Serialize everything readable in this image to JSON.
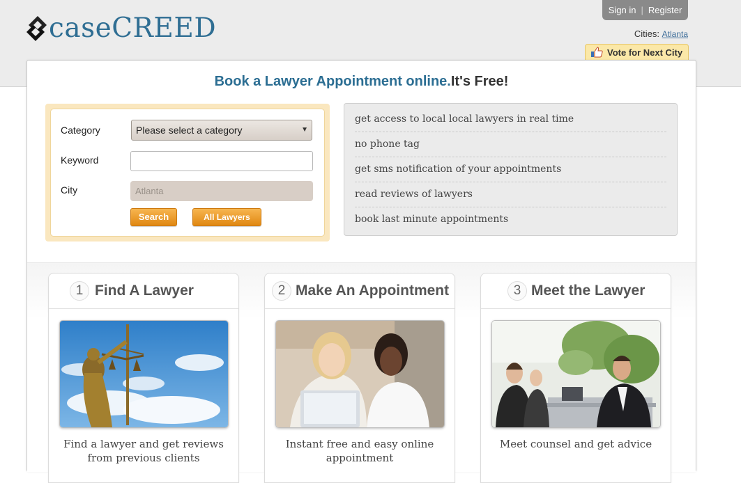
{
  "brand": {
    "logo_text": "caseCREED",
    "logo_icon": "arrow-c-logo-icon",
    "color": "#2f6e93"
  },
  "auth": {
    "sign_in": "Sign in",
    "separator": "|",
    "register": "Register"
  },
  "cities": {
    "label": "Cities:",
    "current": "Atlanta"
  },
  "vote": {
    "label": "Vote for Next City",
    "icon": "thumbs-up-icon"
  },
  "headline": {
    "part1": "Book a Lawyer Appointment online.",
    "part2": "It's Free!"
  },
  "form": {
    "category_label": "Category",
    "category_value": "Please select a category",
    "keyword_label": "Keyword",
    "keyword_value": "",
    "city_label": "City",
    "city_value": "Atlanta",
    "search_button": "Search",
    "all_lawyers_button": "All Lawyers"
  },
  "benefits": [
    "get access to local local lawyers in real time",
    "no phone tag",
    "get sms notification of your appointments",
    "read reviews of lawyers",
    "book last minute appointments"
  ],
  "steps": [
    {
      "number": "1",
      "title": "Find A Lawyer",
      "caption": "Find a lawyer and get reviews from previous clients"
    },
    {
      "number": "2",
      "title": "Make An Appointment",
      "caption": "Instant free and easy online appointment"
    },
    {
      "number": "3",
      "title": "Meet the Lawyer",
      "caption": "Meet counsel and get advice"
    }
  ],
  "colors": {
    "accent_orange": "#e08712",
    "headline_blue": "#2c6e93",
    "form_frame": "#fae7bf"
  }
}
